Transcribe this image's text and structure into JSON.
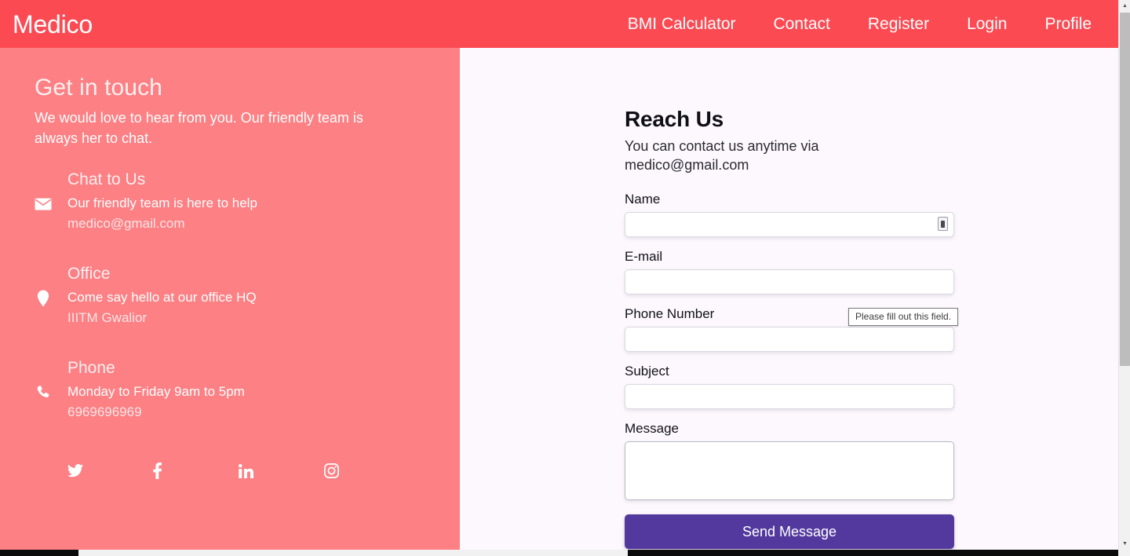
{
  "header": {
    "brand": "Medico",
    "nav": [
      {
        "label": "BMI Calculator",
        "name": "nav-bmi-calculator"
      },
      {
        "label": "Contact",
        "name": "nav-contact"
      },
      {
        "label": "Register",
        "name": "nav-register"
      },
      {
        "label": "Login",
        "name": "nav-login"
      },
      {
        "label": "Profile",
        "name": "nav-profile"
      }
    ],
    "accent_color": "#fc4a53"
  },
  "left_panel": {
    "background_color": "#fc8084",
    "title": "Get in touch",
    "subtitle": "We would love to hear from you. Our friendly team is always her to chat.",
    "blocks": [
      {
        "icon": "envelope-icon",
        "title": "Chat to Us",
        "line1": "Our friendly team is here to help",
        "line2": "medico@gmail.com"
      },
      {
        "icon": "map-pin-icon",
        "title": "Office",
        "line1": "Come say hello at our office HQ",
        "line2": "IIITM Gwalior"
      },
      {
        "icon": "phone-icon",
        "title": "Phone",
        "line1": "Monday to Friday 9am to 5pm",
        "line2": "6969696969"
      }
    ],
    "socials": [
      {
        "name": "twitter-icon",
        "label": "Twitter"
      },
      {
        "name": "facebook-icon",
        "label": "Facebook"
      },
      {
        "name": "linkedin-icon",
        "label": "LinkedIn"
      },
      {
        "name": "instagram-icon",
        "label": "Instagram"
      }
    ]
  },
  "form": {
    "title": "Reach Us",
    "subtitle": "You can contact us anytime via medico@gmail.com",
    "fields": [
      {
        "label": "Name",
        "value": "",
        "placeholder": "",
        "name": "name-input"
      },
      {
        "label": "E-mail",
        "value": "",
        "placeholder": "",
        "name": "email-input"
      },
      {
        "label": "Phone Number",
        "value": "",
        "placeholder": "",
        "name": "phone-input"
      },
      {
        "label": "Subject",
        "value": "",
        "placeholder": "",
        "name": "subject-input"
      },
      {
        "label": "Message",
        "value": "",
        "placeholder": "",
        "name": "message-textarea"
      }
    ],
    "submit_label": "Send Message",
    "submit_color": "#53399e",
    "validation_message": "Please fill out this field."
  }
}
